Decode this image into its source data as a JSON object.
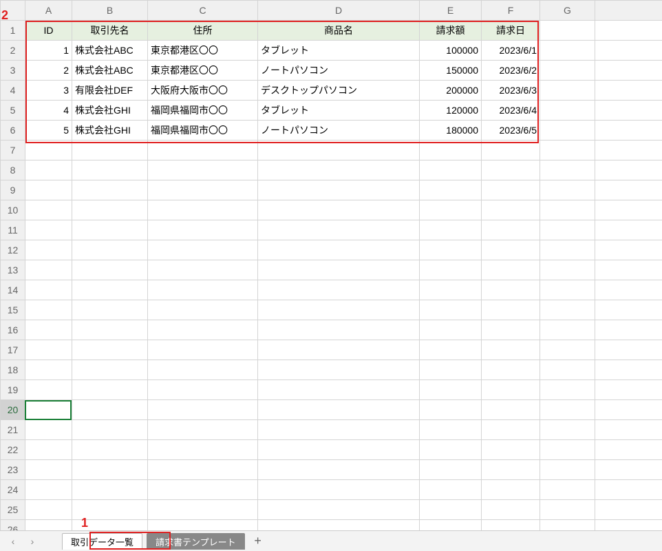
{
  "columns": [
    "A",
    "B",
    "C",
    "D",
    "E",
    "F",
    "G"
  ],
  "rowCount": 26,
  "headers": {
    "A": "ID",
    "B": "取引先名",
    "C": "住所",
    "D": "商品名",
    "E": "請求額",
    "F": "請求日"
  },
  "rows": [
    {
      "id": "1",
      "client": "株式会社ABC",
      "addr": "東京都港区〇〇",
      "product": "タブレット",
      "amount": "100000",
      "date": "2023/6/1"
    },
    {
      "id": "2",
      "client": "株式会社ABC",
      "addr": "東京都港区〇〇",
      "product": "ノートパソコン",
      "amount": "150000",
      "date": "2023/6/2"
    },
    {
      "id": "3",
      "client": "有限会社DEF",
      "addr": "大阪府大阪市〇〇",
      "product": "デスクトップパソコン",
      "amount": "200000",
      "date": "2023/6/3"
    },
    {
      "id": "4",
      "client": "株式会社GHI",
      "addr": "福岡県福岡市〇〇",
      "product": "タブレット",
      "amount": "120000",
      "date": "2023/6/4"
    },
    {
      "id": "5",
      "client": "株式会社GHI",
      "addr": "福岡県福岡市〇〇",
      "product": "ノートパソコン",
      "amount": "180000",
      "date": "2023/6/5"
    }
  ],
  "activeCell": "A20",
  "tabs": {
    "active": "取引データ一覧",
    "inactive": "請求書テンプレート"
  },
  "callouts": {
    "one": "1",
    "two": "2"
  }
}
